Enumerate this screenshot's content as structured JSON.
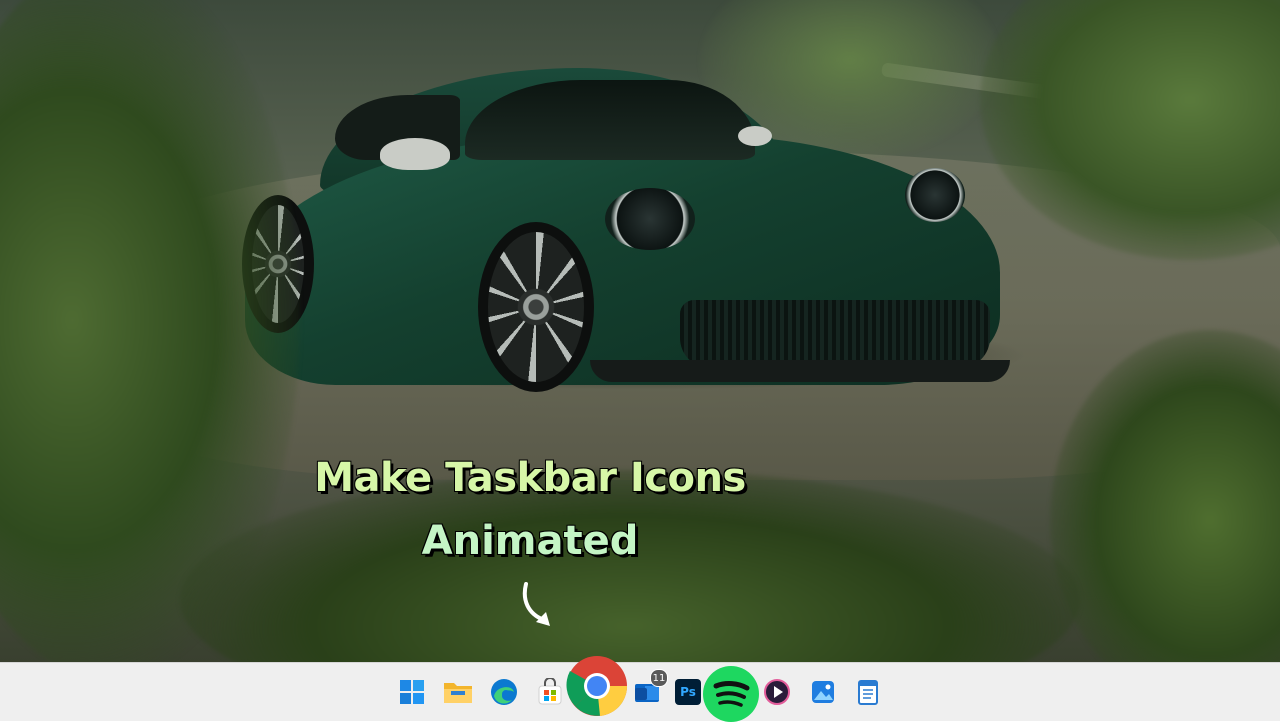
{
  "desktop": {
    "overlay_title_line1": "Make Taskbar Icons",
    "overlay_title_line2": "Animated"
  },
  "taskbar": {
    "items": [
      {
        "name": "start",
        "icon": "windows-start-icon"
      },
      {
        "name": "file-explorer",
        "icon": "folder-icon"
      },
      {
        "name": "edge",
        "icon": "edge-icon"
      },
      {
        "name": "store",
        "icon": "store-icon"
      },
      {
        "name": "chrome",
        "icon": "chrome-icon"
      },
      {
        "name": "outlook",
        "icon": "mail-icon",
        "badge": "11"
      },
      {
        "name": "photoshop",
        "icon": "photoshop-icon",
        "label": "Ps"
      },
      {
        "name": "spotify",
        "icon": "spotify-icon"
      },
      {
        "name": "media-player",
        "icon": "play-icon"
      },
      {
        "name": "photos",
        "icon": "photos-icon"
      },
      {
        "name": "notepad",
        "icon": "notepad-icon"
      }
    ]
  },
  "colors": {
    "title_text": "#d7f7a8",
    "taskbar_bg": "#efefef",
    "car_paint": "#14402f"
  }
}
